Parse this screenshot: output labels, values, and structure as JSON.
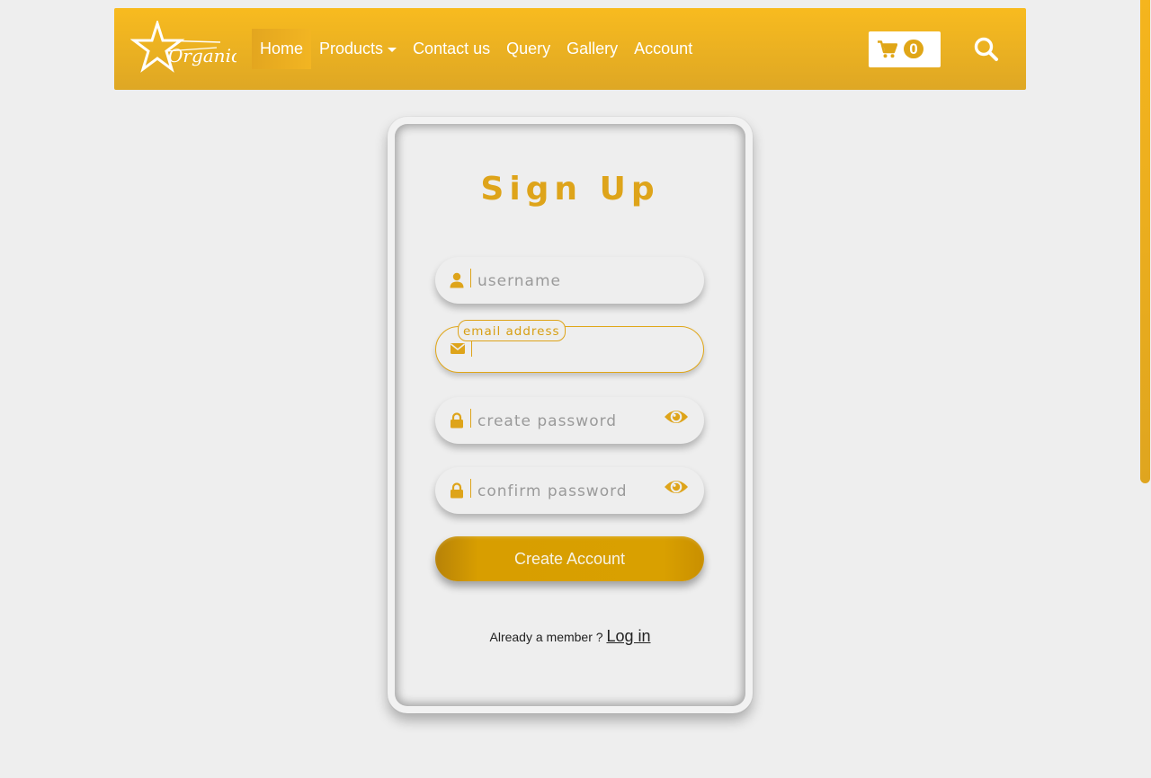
{
  "brand": {
    "logo_text": "Organic"
  },
  "nav": {
    "items": [
      {
        "label": "Home",
        "active": true
      },
      {
        "label": "Products",
        "dropdown": true
      },
      {
        "label": "Contact us"
      },
      {
        "label": "Query"
      },
      {
        "label": "Gallery"
      },
      {
        "label": "Account"
      }
    ],
    "cart_count": "0",
    "cart_icon": "cart-icon",
    "search_icon": "search-icon"
  },
  "form": {
    "title": "Sign Up",
    "username": {
      "placeholder": "username",
      "value": "",
      "icon": "user-icon"
    },
    "email": {
      "label": "email address",
      "value": "",
      "icon": "envelope-icon"
    },
    "password": {
      "placeholder": "create password",
      "value": "",
      "icon": "lock-icon",
      "toggle_icon": "eye-icon"
    },
    "confirm_password": {
      "placeholder": "confirm password",
      "value": "",
      "icon": "lock-icon",
      "toggle_icon": "eye-icon"
    },
    "submit_label": "Create Account",
    "member_text": "Already a member ?",
    "login_link": "Log in"
  },
  "colors": {
    "accent": "#dea41a",
    "navbar_top": "#f8bb1f",
    "navbar_bottom": "#dea724",
    "background": "#eeeeee"
  }
}
